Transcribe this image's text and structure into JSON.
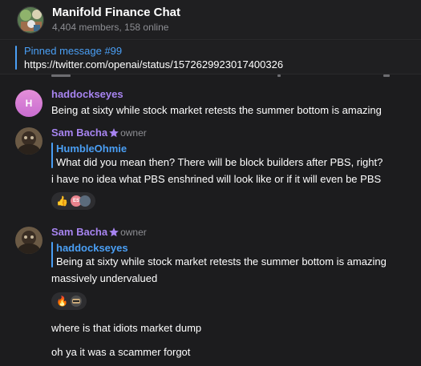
{
  "header": {
    "title": "Manifold Finance Chat",
    "subtitle": "4,404 members, 158 online"
  },
  "pinned": {
    "label": "Pinned message #99",
    "text": "https://twitter.com/openai/status/1572629923017400326"
  },
  "messages": [
    {
      "sender": "haddockseyes",
      "avatar_initial": "H",
      "text": "Being at sixty while stock market retests the summer bottom is amazing"
    },
    {
      "sender": "Sam Bacha",
      "role": "owner",
      "reply_to": "HumbleOhmie",
      "reply_text": "What did you mean then? There will be block builders after PBS, right?",
      "text": "i have no idea what PBS enshrined will look like or if it will even be PBS",
      "reactions": [
        {
          "emoji": "👍",
          "avatars": [
            "ES"
          ]
        }
      ]
    },
    {
      "sender": "Sam Bacha",
      "role": "owner",
      "reply_to": "haddockseyes",
      "reply_text": "Being at sixty while stock market retests the summer bottom is amazing",
      "text": "massively undervalued",
      "reactions": [
        {
          "emoji": "🔥",
          "avatars": []
        }
      ],
      "followups": [
        "where is that idiots market dump",
        "oh ya it was a scammer forgot"
      ]
    }
  ],
  "colors": {
    "background": "#1c1c1e",
    "accent_blue": "#4a9ff5",
    "sender_purple": "#a784f0",
    "muted": "#8d8e93"
  }
}
